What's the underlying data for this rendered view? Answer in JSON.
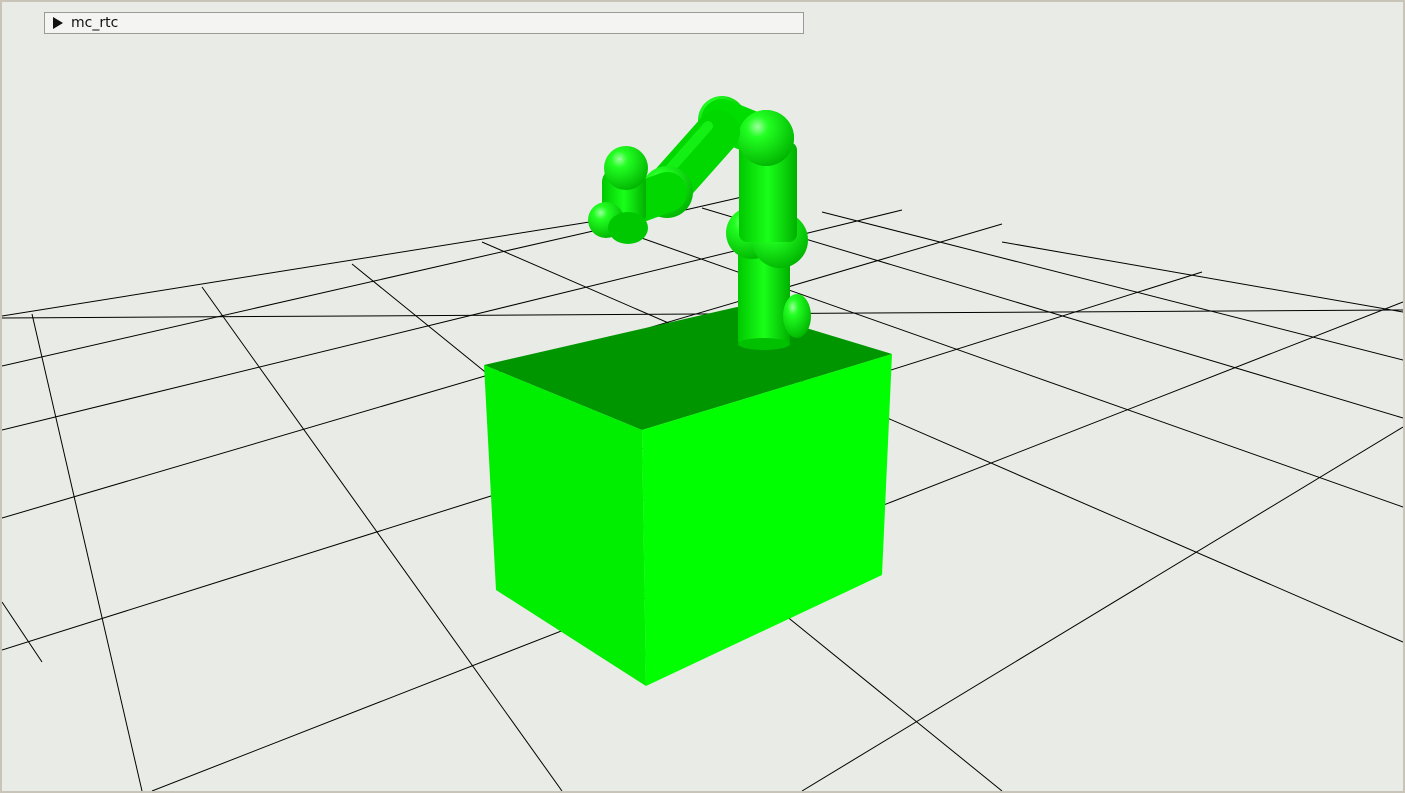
{
  "panel": {
    "title": "mc_rtc"
  },
  "scene": {
    "background": "#e9ece6",
    "grid_color": "#000000",
    "robot_color": "#00ff00",
    "box_color": "#00ff00",
    "box_top_color": "#009600"
  }
}
